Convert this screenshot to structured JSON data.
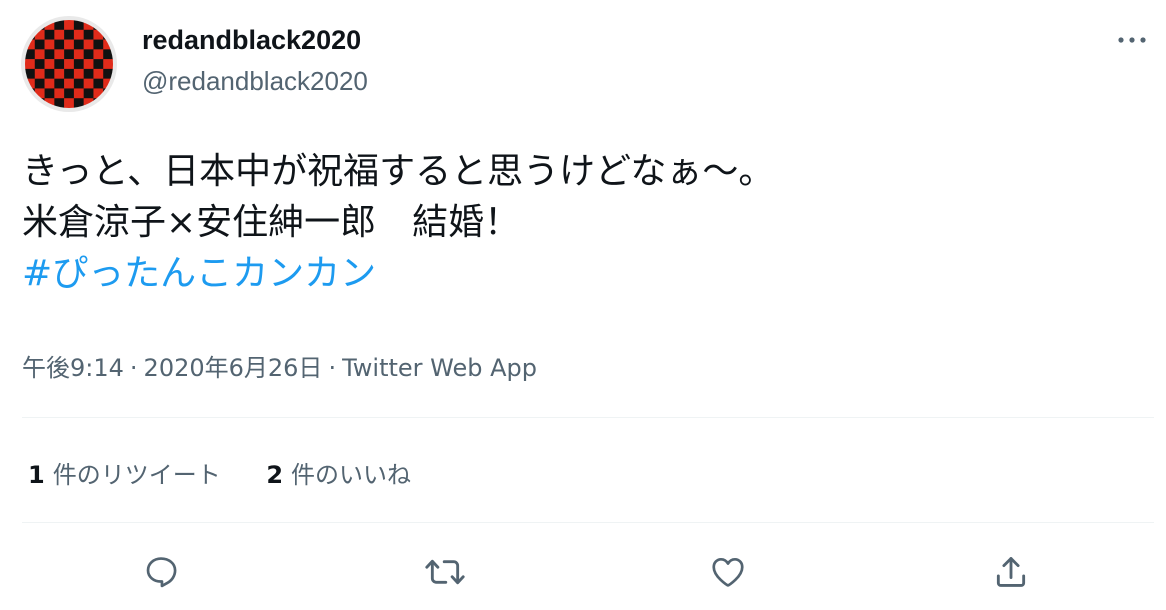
{
  "user": {
    "display_name": "redandblack2020",
    "handle": "@redandblack2020",
    "avatar_colors": {
      "primary": "#e02b1a",
      "secondary": "#111111"
    }
  },
  "more_icon": "more-horizontal-icon",
  "tweet": {
    "lines": [
      "きっと、日本中が祝福すると思うけどなぁ〜。",
      "米倉涼子×安住紳一郎　結婚！"
    ],
    "hashtag": "#ぴったんこカンカン"
  },
  "meta": {
    "time": "午後9:14",
    "date": "2020年6月26日",
    "separator": "·",
    "source": "Twitter Web App"
  },
  "stats": {
    "retweets": {
      "count": "1",
      "label": "件のリツイート"
    },
    "likes": {
      "count": "2",
      "label": "件のいいね"
    }
  },
  "actions": [
    {
      "name": "reply-icon"
    },
    {
      "name": "retweet-icon"
    },
    {
      "name": "like-icon"
    },
    {
      "name": "share-icon"
    }
  ],
  "colors": {
    "text": "#0f1419",
    "secondary_text": "#536471",
    "link": "#1d9bf0",
    "divider": "#eff3f4"
  }
}
